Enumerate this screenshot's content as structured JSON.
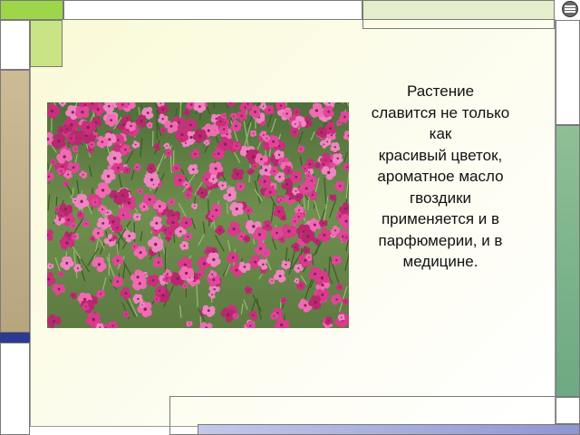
{
  "slide": {
    "text_lines": [
      "Растение",
      "славится не только",
      "как",
      "красивый цветок,",
      "ароматное масло",
      "гвоздики",
      "применяется и в",
      "парфюмерии, и в",
      "медицине."
    ]
  },
  "photo": {
    "subject": "pink carnation flower field"
  },
  "icons": {
    "corner": "navigation-icon"
  },
  "colors": {
    "accent_green": "#9ed64a",
    "light_green": "#c9e484",
    "tan": "#cdbb95",
    "navy": "#2a3a95",
    "right_green": "#8ebf95",
    "bottom_blue": "#8d96d3",
    "slide_background": "#fafad6",
    "flower_pink": "#e0479a"
  }
}
